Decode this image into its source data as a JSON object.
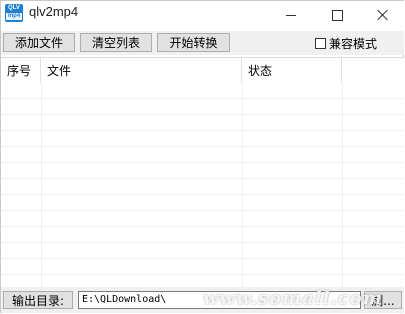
{
  "window": {
    "title": "qlv2mp4",
    "icon_text_top": "QLV",
    "icon_text_bottom": "mp4"
  },
  "toolbar": {
    "add_label": "添加文件",
    "clear_label": "清空列表",
    "start_label": "开始转换",
    "compat_label": "兼容模式",
    "compat_checked": false
  },
  "table": {
    "columns": [
      "序号",
      "文件",
      "状态"
    ],
    "rows": []
  },
  "bottom": {
    "output_label": "输出目录:",
    "output_path": "E:\\QLDownload\\",
    "browse_label": "浏..."
  },
  "watermark": "www.somall.com"
}
